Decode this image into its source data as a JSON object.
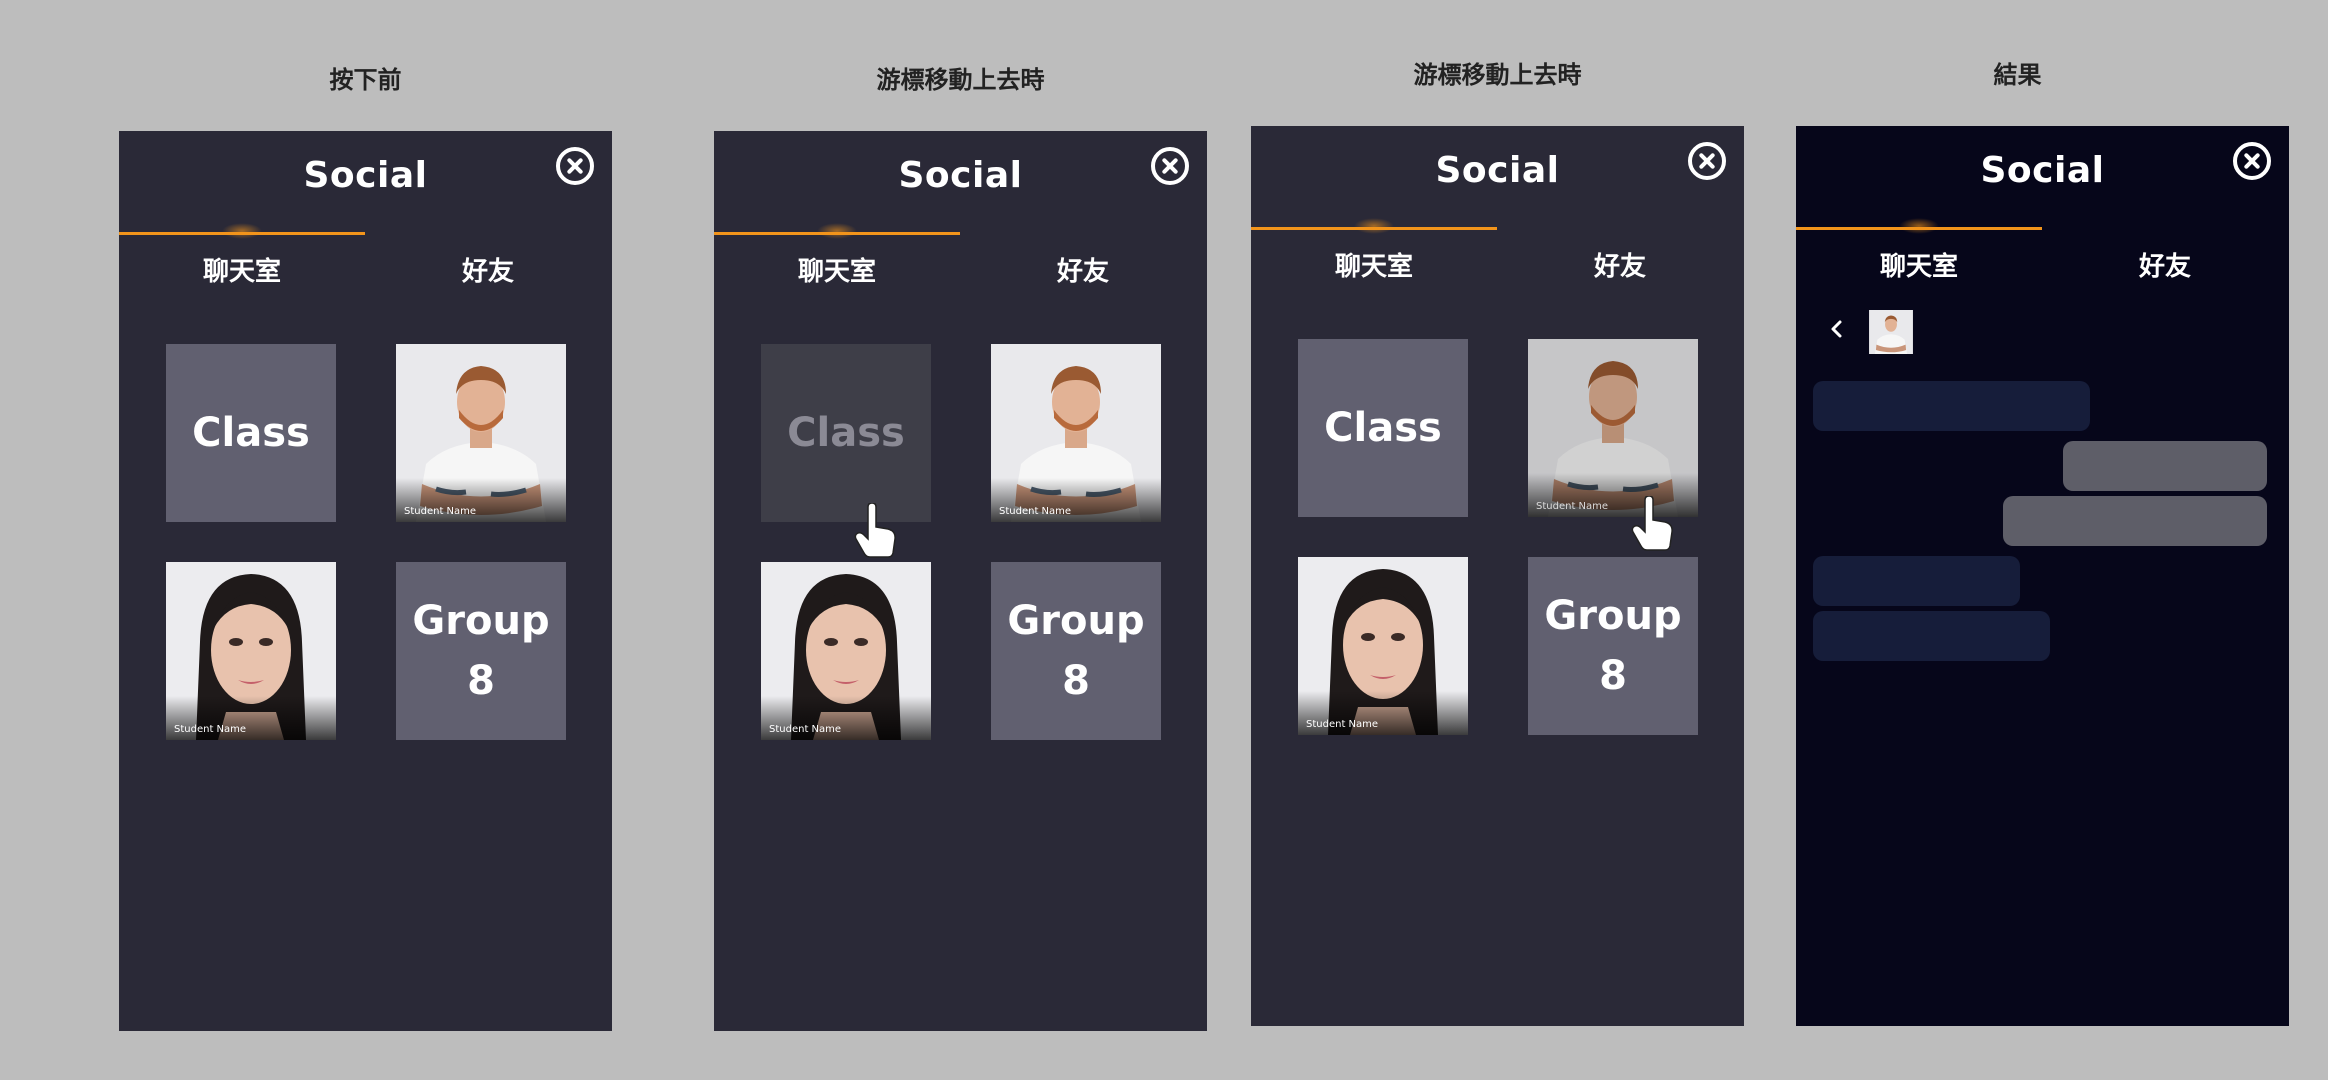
{
  "captions": [
    "按下前",
    "游標移動上去時",
    "游標移動上去時",
    "結果"
  ],
  "social": {
    "title": "Social",
    "tabs": [
      "聊天室",
      "好友"
    ],
    "tiles": {
      "class_label": "Class",
      "group_line1": "Group",
      "group_line2": "8",
      "student_name": "Student Name"
    }
  },
  "icons": {
    "close": "close-circle-icon",
    "cursor": "hand-pointer-icon",
    "back": "chevron-left-icon"
  },
  "colors": {
    "background": "#bdbdbd",
    "panel": "#2a2937",
    "panel_dark": "#06061a",
    "accent": "#f2941b",
    "tile": "#616070",
    "incoming_bubble": "#161d3a",
    "outgoing_bubble": "#5e5e68"
  }
}
